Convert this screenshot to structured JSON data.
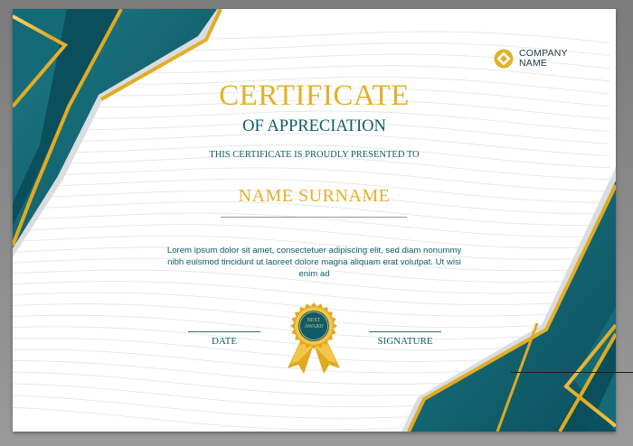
{
  "certificate": {
    "company_line1": "COMPANY",
    "company_line2": "NAME",
    "title": "CERTIFICATE",
    "subtitle": "OF APPRECIATION",
    "presented_to": "THIS CERTIFICATE IS PROUDLY PRESENTED TO",
    "recipient_name": "NAME SURNAME",
    "body_text": "Lorem ipsum dolor sit amet, consectetuer adipiscing elit, sed diam nonummy nibh euismod tincidunt ut laoreet dolore magna aliquam erat volutpat. Ut wisi enim ad",
    "date_label": "DATE",
    "signature_label": "SIGNATURE",
    "badge_line1": "BEST",
    "badge_line2": "AWARD"
  },
  "colors": {
    "teal": "#0f5b6b",
    "gold": "#e2b12a",
    "paper": "#ffffff"
  }
}
